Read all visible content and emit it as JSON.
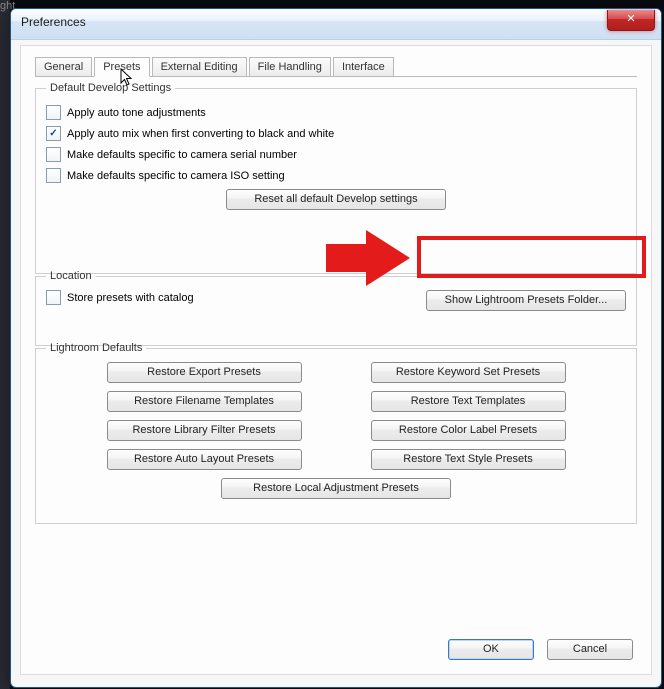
{
  "bg_hint": "ght",
  "window": {
    "title": "Preferences"
  },
  "tabs": {
    "general": "General",
    "presets": "Presets",
    "external": "External Editing",
    "files": "File Handling",
    "interface": "Interface",
    "active": "presets"
  },
  "develop": {
    "legend": "Default Develop Settings",
    "auto_tone": "Apply auto tone adjustments",
    "auto_mix": "Apply auto mix when first converting to black and white",
    "serial": "Make defaults specific to camera serial number",
    "iso": "Make defaults specific to camera ISO setting",
    "reset_btn": "Reset all default Develop settings"
  },
  "location": {
    "legend": "Location",
    "store": "Store presets with catalog",
    "show_btn": "Show Lightroom Presets Folder..."
  },
  "defaults": {
    "legend": "Lightroom Defaults",
    "export": "Restore Export Presets",
    "keyword": "Restore Keyword Set Presets",
    "filename": "Restore Filename Templates",
    "text": "Restore Text Templates",
    "library": "Restore Library Filter Presets",
    "colorlabel": "Restore Color Label Presets",
    "autolayout": "Restore Auto Layout Presets",
    "textstyle": "Restore Text Style Presets",
    "local": "Restore Local Adjustment Presets"
  },
  "footer": {
    "ok": "OK",
    "cancel": "Cancel"
  }
}
